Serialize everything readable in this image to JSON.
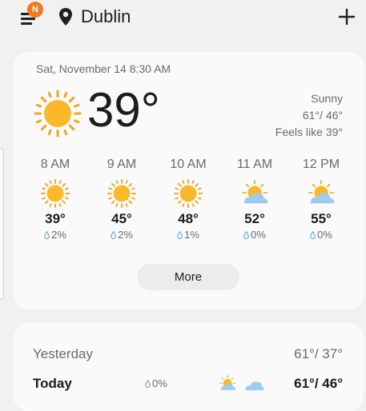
{
  "header": {
    "notification_badge": "N",
    "city": "Dublin",
    "icons": {
      "menu": "menu-icon",
      "location": "location-pin-icon",
      "add": "plus-icon"
    }
  },
  "current": {
    "datetime": "Sat, November 14 8:30 AM",
    "temperature": "39°",
    "condition": "Sunny",
    "high_low": "61°/ 46°",
    "feels_like": "Feels like 39°",
    "icon": "sun-icon"
  },
  "hourly": [
    {
      "time": "8 AM",
      "temp": "39°",
      "precip": "2%",
      "icon": "sun-icon"
    },
    {
      "time": "9 AM",
      "temp": "45°",
      "precip": "2%",
      "icon": "sun-icon"
    },
    {
      "time": "10 AM",
      "temp": "48°",
      "precip": "1%",
      "icon": "sun-icon"
    },
    {
      "time": "11 AM",
      "temp": "52°",
      "precip": "0%",
      "icon": "partly-cloudy-icon"
    },
    {
      "time": "12 PM",
      "temp": "55°",
      "precip": "0%",
      "icon": "partly-cloudy-icon"
    }
  ],
  "more_label": "More",
  "daily": {
    "yesterday": {
      "label": "Yesterday",
      "range": "61°/ 37°"
    },
    "today": {
      "label": "Today",
      "precip": "0%",
      "range": "61°/ 46°",
      "icons": [
        "partly-cloudy-icon",
        "cloud-icon"
      ]
    }
  },
  "colors": {
    "sun": "#fbb829",
    "sun_ray": "#f5a623",
    "cloud": "#9ecbee",
    "badge": "#f07a1e",
    "card": "#fafafa",
    "background": "#f1f1f1"
  }
}
